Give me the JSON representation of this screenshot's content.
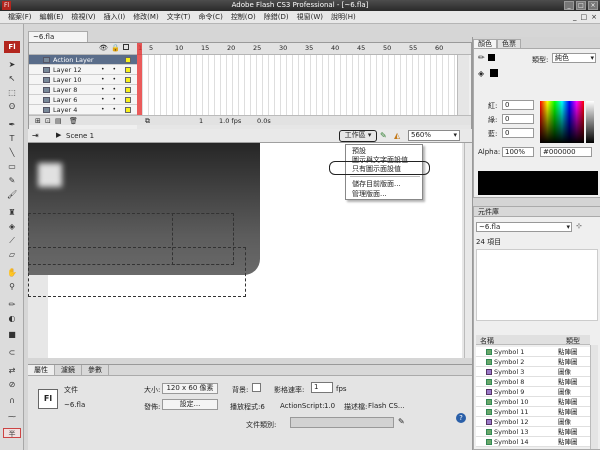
{
  "app": {
    "title": "Adobe Flash CS3 Professional - [~6.fla]",
    "icon": "Fl"
  },
  "window_controls": [
    "_",
    "□",
    "×"
  ],
  "menu": [
    "檔案(F)",
    "編輯(E)",
    "檢視(V)",
    "插入(I)",
    "修改(M)",
    "文字(T)",
    "命令(C)",
    "控制(O)",
    "除錯(D)",
    "視窗(W)",
    "說明(H)"
  ],
  "menu_controls": [
    "_",
    "□",
    "×"
  ],
  "document_tab": "~6.fla",
  "timeline": {
    "frame_numbers": [
      "1",
      "5",
      "10",
      "15",
      "20",
      "25",
      "30",
      "35",
      "40",
      "45",
      "50",
      "55",
      "60"
    ],
    "layers": [
      "Action Layer",
      "Layer 12",
      "Layer 10",
      "Layer 8",
      "Layer 6",
      "Layer 4"
    ],
    "status": {
      "frame": "1",
      "fps": "1.0 fps",
      "time": "0.0s"
    }
  },
  "editbar": {
    "scene": "Scene 1",
    "workspace_button": "工作區",
    "zoom": "560%"
  },
  "workspace_menu": {
    "items": [
      "預設",
      "圖示與文字面設值",
      "只有圖示面設值",
      "儲存目前版面...",
      "管理版面..."
    ]
  },
  "properties": {
    "tabs": [
      "屬性",
      "濾鏡",
      "參數"
    ],
    "doc_type": "文件",
    "doc_name": "~6.fla",
    "size_label": "大小:",
    "size_value": "120 x 60 像素",
    "background_label": "背景:",
    "frame_rate_label": "影格速率:",
    "frame_rate_value": "1",
    "fps_unit": "fps",
    "publish_label": "發佈:",
    "settings_button": "設定...",
    "player_label": "播放程式:6",
    "actionscript_label": "ActionScript:",
    "actionscript_value": "1.0",
    "profile_label": "描述檔:",
    "profile_value": "Flash CS...",
    "doc_class_label": "文件類別:"
  },
  "color_panel": {
    "tabs": [
      "顏色",
      "色票"
    ],
    "type_label": "類型:",
    "type_value": "純色",
    "red_label": "紅:",
    "red_value": "0",
    "green_label": "綠:",
    "green_value": "0",
    "blue_label": "藍:",
    "blue_value": "0",
    "alpha_label": "Alpha:",
    "alpha_value": "100%",
    "hex_value": "#000000"
  },
  "library": {
    "title": "元件庫",
    "file": "~6.fla",
    "count": "24 項目",
    "columns": [
      "名稱",
      "類型"
    ],
    "items": [
      {
        "name": "Symbol 1",
        "type": "點陣圖"
      },
      {
        "name": "Symbol 2",
        "type": "點陣圖"
      },
      {
        "name": "Symbol 3",
        "type": "圖像"
      },
      {
        "name": "Symbol 8",
        "type": "點陣圖"
      },
      {
        "name": "Symbol 9",
        "type": "圖像"
      },
      {
        "name": "Symbol 10",
        "type": "點陣圖"
      },
      {
        "name": "Symbol 11",
        "type": "點陣圖"
      },
      {
        "name": "Symbol 12",
        "type": "圖像"
      },
      {
        "name": "Symbol 13",
        "type": "點陣圖"
      },
      {
        "name": "Symbol 14",
        "type": "點陣圖"
      }
    ]
  },
  "colors": {
    "accent": "#b3261e",
    "selected_layer": "#5a6d8a",
    "keyframe": "#f7f11a"
  }
}
